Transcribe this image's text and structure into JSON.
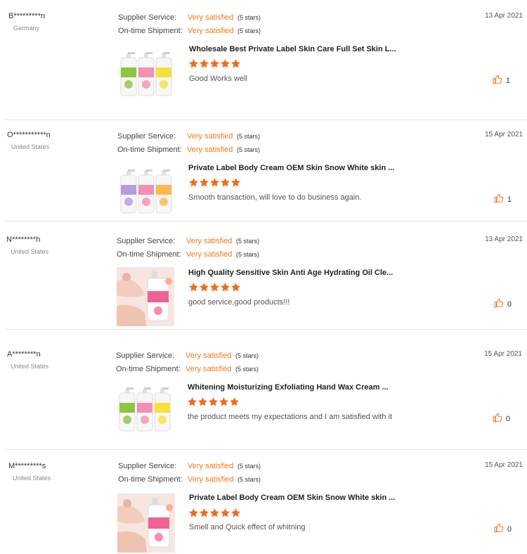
{
  "labels": {
    "supplier_service": "Supplier Service:",
    "ontime_shipment": "On-time Shipment:"
  },
  "colors": {
    "accent": "#f07818",
    "star": "#f26b1c",
    "separator": "#e3e3e3"
  },
  "icons": {
    "like": "thumbs-up-icon",
    "star": "star-icon"
  },
  "reviews": [
    {
      "buyer": "B*********n",
      "country": "Germany",
      "supplier_value": "Very satisfied",
      "supplier_stars": "(5 stars)",
      "shipment_value": "Very satisfied",
      "shipment_stars": "(5 stars)",
      "date": "13 Apr 2021",
      "product_title": "Wholesale Best Private Label Skin Care Full Set Skin L...",
      "rating": 5,
      "comment": "Good Works well",
      "likes": "1",
      "thumb": "bottles-green-pink-yellow"
    },
    {
      "buyer": "O***********n",
      "country": "United States",
      "supplier_value": "Very satisfied",
      "supplier_stars": "(5 stars)",
      "shipment_value": "Very satisfied",
      "shipment_stars": "(5 stars)",
      "date": "15 Apr 2021",
      "product_title": "Private Label Body Cream OEM Skin Snow White skin ...",
      "rating": 5,
      "comment": "Smooth transaction, will love to do business again.",
      "likes": "1",
      "thumb": "bottles-purple-pink-orange"
    },
    {
      "buyer": "N********h",
      "country": "United States",
      "supplier_value": "Very satisfied",
      "supplier_stars": "(5 stars)",
      "shipment_value": "Very satisfied",
      "shipment_stars": "(5 stars)",
      "date": "13 Apr 2021",
      "product_title": "High Quality Sensitive Skin Anti Age Hydrating Oil Cle...",
      "rating": 5,
      "comment": "good service,good products!!!",
      "likes": "0",
      "thumb": "skin-photo-bottle"
    },
    {
      "buyer": "A********n",
      "country": "United States",
      "supplier_value": "Very satisfied",
      "supplier_stars": "(5 stars)",
      "shipment_value": "Very satisfied",
      "shipment_stars": "(5 stars)",
      "date": "15 Apr 2021",
      "product_title": "Whitening Moisturizing Exfoliating Hand Wax Cream ...",
      "rating": 5,
      "comment": "the product meets my expectations and I am satisfied with it",
      "likes": "0",
      "thumb": "bottles-green-pink-yellow"
    },
    {
      "buyer": "M*********s",
      "country": "United States",
      "supplier_value": "Very satisfied",
      "supplier_stars": "(5 stars)",
      "shipment_value": "Very satisfied",
      "shipment_stars": "(5 stars)",
      "date": "15 Apr 2021",
      "product_title": "Private Label Body Cream OEM Skin Snow White skin ...",
      "rating": 5,
      "comment": "Smell and  Quick effect of whitning",
      "likes": "0",
      "thumb": "skin-photo-bottle"
    }
  ]
}
